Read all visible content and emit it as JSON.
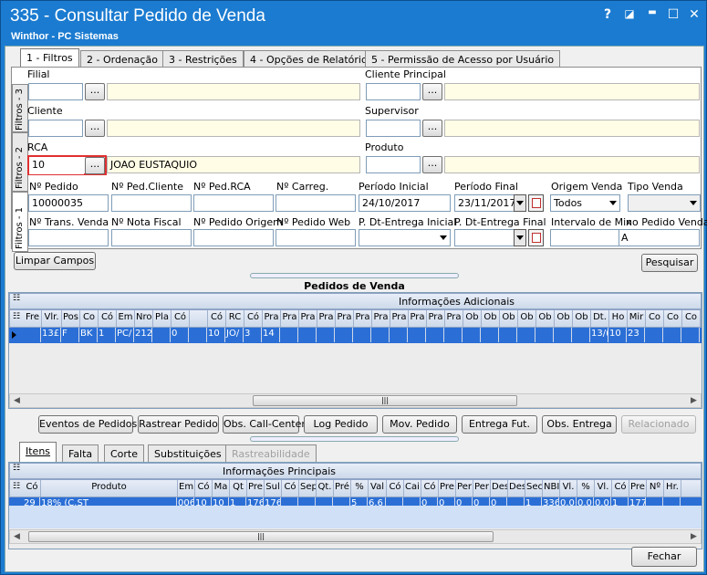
{
  "window": {
    "title": "335 - Consultar Pedido de Venda",
    "subtitle": "Winthor - PC Sistemas",
    "controls": {
      "help": "?",
      "edit": "◪",
      "minimize": "▬",
      "maximize": "☐",
      "close": "✕"
    }
  },
  "tabs": [
    {
      "label": "1 - Filtros"
    },
    {
      "label": "2 - Ordenação"
    },
    {
      "label": "3 - Restrições"
    },
    {
      "label": "4 - Opções de Relatório"
    },
    {
      "label": "5 - Permissão de Acesso por Usuário"
    }
  ],
  "vtabs": [
    "Filtros - 1",
    "Filtros - 2",
    "Filtros - 3"
  ],
  "filters": {
    "filial_label": "Filial",
    "cliente_principal_label": "Cliente Principal",
    "cliente_label": "Cliente",
    "supervisor_label": "Supervisor",
    "rca_label": "RCA",
    "rca_value": "10",
    "rca_name": "JOAO EUSTAQUIO",
    "produto_label": "Produto",
    "dots": "...",
    "npedido_label": "Nº Pedido",
    "npedido_value": "10000035",
    "npedcliente_label": "Nº Ped.Cliente",
    "npedrca_label": "Nº Ped.RCA",
    "ncarreg_label": "Nº Carreg.",
    "periodo_inicial_label": "Período Inicial",
    "periodo_inicial_value": "24/10/2017",
    "periodo_final_label": "Período Final",
    "periodo_final_value": "23/11/2017",
    "origem_venda_label": "Origem Venda",
    "origem_venda_value": "Todos",
    "tipo_venda_label": "Tipo Venda",
    "ntrans_label": "Nº Trans. Venda",
    "nnota_label": "Nº Nota Fiscal",
    "npedorigem_label": "Nº Pedido Origem",
    "npedweb_label": "Nº Pedido Web",
    "pdt_inicial_label": "P. Dt-Entrega Inicial",
    "pdt_final_label": "P. Dt-Entrega Final",
    "intervalo_label": "Intervalo de Mix",
    "nopedido_label": "no Pedido Venda",
    "nopedido_value": "A"
  },
  "buttons": {
    "limpar": "Limpar Campos",
    "pesquisar": "Pesquisar",
    "eventos": "Eventos de Pedidos",
    "rastrear": "Rastrear Pedido",
    "obs_call": "Obs. Call-Center",
    "log": "Log Pedido",
    "mov": "Mov. Pedido",
    "entrega": "Entrega Fut.",
    "obs_entrega": "Obs. Entrega",
    "relacionado": "Relacionado",
    "fechar": "Fechar"
  },
  "pedidos": {
    "section_title": "Pedidos de  Venda",
    "group_header": "Informações Adicionais",
    "columns": [
      "Fre",
      "Vlr.",
      "Pos",
      "Co",
      "Có",
      "Em",
      "Nro",
      "Pla",
      "Có",
      "",
      "Có",
      "RC",
      "Có",
      "Pra",
      "Pra",
      "Pra",
      "Pra",
      "Pra",
      "Pra",
      "Pra",
      "Pra",
      "Pra",
      "Pra",
      "Pra",
      "Ob",
      "Ob",
      "Ob",
      "Ob",
      "Ob",
      "Ob",
      "Ob",
      "Dt.",
      "Ho",
      "Mir",
      "Co",
      "Co",
      "Co"
    ],
    "row": [
      "",
      "13£",
      "F",
      "BK",
      "1",
      "PC/",
      "212",
      "",
      "0",
      "",
      "10",
      "JO/",
      "3",
      "14",
      "",
      "",
      "",
      "",
      "",
      "",
      "",
      "",
      "",
      "",
      "",
      "",
      "",
      "",
      "",
      "",
      "",
      "13/(",
      "10",
      "23",
      "",
      "",
      ""
    ]
  },
  "bottom_tabs": [
    "Itens",
    "Falta",
    "Corte",
    "Substituições",
    "Rastreabilidade"
  ],
  "itens": {
    "group_header": "Informações Principais",
    "columns": [
      "Có",
      "Produto",
      "Em",
      "Có",
      "Ma",
      "Qt",
      "Pre",
      "Sul",
      "Có",
      "Sep",
      "Qt.",
      "Pré",
      "%",
      "Val",
      "Có",
      "Cai",
      "Có",
      "Pre",
      "Per",
      "Per",
      "Des",
      "Des",
      "Sec",
      "NBI",
      "Vl.",
      "%",
      "Vl.",
      "Có",
      "Pre",
      "Nº",
      "Hr."
    ],
    "row": [
      "29",
      "18% (C.ST",
      "006",
      "10",
      "10",
      "1",
      "176",
      "176",
      "",
      "",
      "",
      "",
      "5",
      "6.6",
      "",
      "",
      "0",
      "0",
      "0",
      "0",
      "0",
      "",
      "1",
      "336",
      "0.0",
      "0.0",
      "0.0",
      "1",
      "177",
      "",
      ""
    ]
  },
  "colors": {
    "titlebar": "#1b7bd0",
    "grid_selected": "#2b6fd6",
    "readonly": "#fffde6",
    "highlight": "#e03030"
  }
}
